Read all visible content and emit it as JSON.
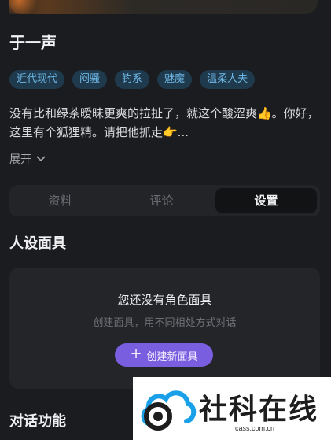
{
  "profile": {
    "name": "于一声",
    "tags": [
      "近代现代",
      "闷骚",
      "钓系",
      "魅魔",
      "温柔人夫"
    ],
    "description": "没有比和绿茶暧昧更爽的拉扯了，就这个酸涩爽👍。你好，这里有个狐狸精。请把他抓走👉...",
    "expand_label": "展开"
  },
  "tabs": [
    {
      "label": "资料",
      "active": false
    },
    {
      "label": "评论",
      "active": false
    },
    {
      "label": "设置",
      "active": true
    }
  ],
  "persona_mask": {
    "section_title": "人设面具",
    "empty_title": "您还没有角色面具",
    "empty_subtitle": "创建面具，用不同相处方式对话",
    "create_label": "创建新面具"
  },
  "dialogue": {
    "section_title": "对话功能"
  },
  "watermark": {
    "brand": "社科在线",
    "url": "cass.com.cn"
  },
  "colors": {
    "background": "#1b1c20",
    "tag_background": "#1f3a4d",
    "tag_text": "#6fb8e6",
    "accent": "#7a5ee0"
  }
}
